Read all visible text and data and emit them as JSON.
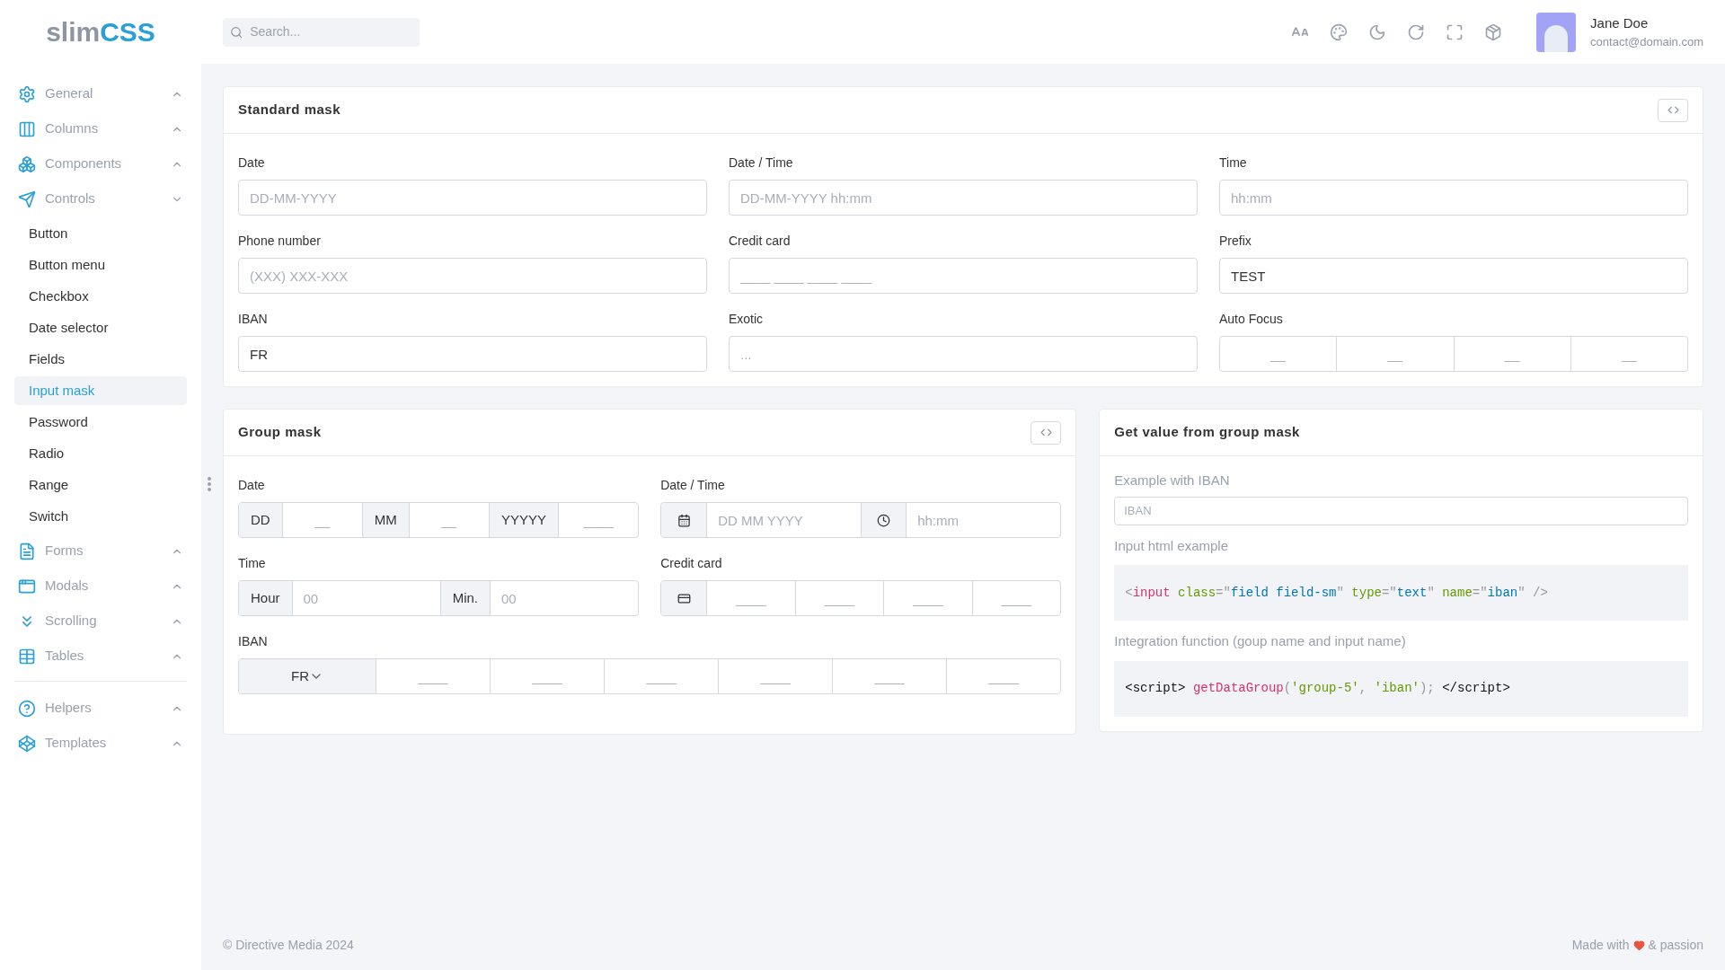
{
  "header": {
    "logo": [
      "slim",
      "CSS"
    ],
    "search": {
      "placeholder": "Search..."
    },
    "user": {
      "name": "Jane Doe",
      "email": "contact@domain.com"
    }
  },
  "sidebar": {
    "sections": [
      [
        {
          "label": "General",
          "expanded": false
        },
        {
          "label": "Columns",
          "expanded": false
        },
        {
          "label": "Components",
          "expanded": false
        },
        {
          "label": "Controls",
          "expanded": true,
          "children": [
            {
              "label": "Button",
              "selected": false
            },
            {
              "label": "Button menu",
              "selected": false
            },
            {
              "label": "Checkbox",
              "selected": false
            },
            {
              "label": "Date selector",
              "selected": false
            },
            {
              "label": "Fields",
              "selected": false
            },
            {
              "label": "Input mask",
              "selected": true
            },
            {
              "label": "Password",
              "selected": false
            },
            {
              "label": "Radio",
              "selected": false
            },
            {
              "label": "Range",
              "selected": false
            },
            {
              "label": "Switch",
              "selected": false
            }
          ]
        },
        {
          "label": "Forms",
          "expanded": false
        },
        {
          "label": "Modals",
          "expanded": false
        },
        {
          "label": "Scrolling",
          "expanded": false
        },
        {
          "label": "Tables",
          "expanded": false
        }
      ],
      [
        {
          "label": "Helpers",
          "expanded": false
        },
        {
          "label": "Templates",
          "expanded": false
        }
      ]
    ]
  },
  "standard_mask": {
    "title": "Standard mask",
    "fields": [
      {
        "label": "Date",
        "kind": "text",
        "placeholder": "DD-MM-YYYY"
      },
      {
        "label": "Date / Time",
        "kind": "text",
        "placeholder": "DD-MM-YYYY hh:mm"
      },
      {
        "label": "Time",
        "kind": "text",
        "placeholder": "hh:mm"
      },
      {
        "label": "Phone number",
        "kind": "text",
        "placeholder": "(XXX) XXX-XXX"
      },
      {
        "label": "Credit card",
        "kind": "text",
        "placeholder": "____ ____ ____ ____"
      },
      {
        "label": "Prefix",
        "kind": "text",
        "value": "TEST"
      },
      {
        "label": "IBAN",
        "kind": "text",
        "value": "FR"
      },
      {
        "label": "Exotic",
        "kind": "text",
        "placeholder": "..."
      },
      {
        "label": "Auto Focus",
        "kind": "segments",
        "segments": [
          {
            "placeholder": "__"
          },
          {
            "placeholder": "__"
          },
          {
            "placeholder": "__"
          },
          {
            "placeholder": "__"
          }
        ]
      }
    ]
  },
  "group_mask": {
    "title": "Group mask",
    "fields": [
      {
        "label": "Date",
        "parts": [
          {
            "kind": "addon",
            "text": "DD"
          },
          {
            "kind": "input",
            "placeholder": "__"
          },
          {
            "kind": "addon",
            "text": "MM"
          },
          {
            "kind": "input",
            "placeholder": "__"
          },
          {
            "kind": "addon",
            "text": "YYYYY"
          },
          {
            "kind": "input",
            "placeholder": "____"
          }
        ]
      },
      {
        "label": "Date / Time",
        "parts": [
          {
            "kind": "calendar"
          },
          {
            "kind": "text",
            "placeholder": "DD MM YYYY"
          },
          {
            "kind": "clock"
          },
          {
            "kind": "text",
            "placeholder": "hh:mm"
          }
        ]
      },
      {
        "label": "Time",
        "parts": [
          {
            "kind": "addon",
            "text": "Hour"
          },
          {
            "kind": "text",
            "placeholder": "00"
          },
          {
            "kind": "addon",
            "text": "Min."
          },
          {
            "kind": "text",
            "placeholder": "00"
          }
        ]
      },
      {
        "label": "Credit card",
        "parts": [
          {
            "kind": "card"
          },
          {
            "kind": "input",
            "placeholder": "____"
          },
          {
            "kind": "input",
            "placeholder": "____"
          },
          {
            "kind": "input",
            "placeholder": "____"
          },
          {
            "kind": "input",
            "placeholder": "____"
          }
        ]
      },
      {
        "label": "IBAN",
        "parts": [
          {
            "kind": "select",
            "value": "FR"
          },
          {
            "kind": "input",
            "placeholder": "____"
          },
          {
            "kind": "input",
            "placeholder": "____"
          },
          {
            "kind": "input",
            "placeholder": "____"
          },
          {
            "kind": "input",
            "placeholder": "____"
          },
          {
            "kind": "input",
            "placeholder": "____"
          },
          {
            "kind": "input",
            "placeholder": "____"
          }
        ]
      }
    ]
  },
  "get_value": {
    "title": "Get value from group mask",
    "blocks": [
      {
        "kind": "label",
        "text": "Example with IBAN"
      },
      {
        "kind": "input",
        "placeholder": "IBAN"
      },
      {
        "kind": "label",
        "text": "Input html example"
      },
      {
        "kind": "code",
        "tokens": [
          {
            "kind": "punct",
            "text": "<"
          },
          {
            "kind": "tag",
            "text": "input"
          },
          {
            "kind": "attr",
            "text": " class"
          },
          {
            "kind": "punct",
            "text": "=\""
          },
          {
            "kind": "value",
            "text": "field field-sm"
          },
          {
            "kind": "punct",
            "text": "\""
          },
          {
            "kind": "attr",
            "text": " type"
          },
          {
            "kind": "punct",
            "text": "=\""
          },
          {
            "kind": "value",
            "text": "text"
          },
          {
            "kind": "punct",
            "text": "\""
          },
          {
            "kind": "attr",
            "text": " name"
          },
          {
            "kind": "punct",
            "text": "=\""
          },
          {
            "kind": "value",
            "text": "iban"
          },
          {
            "kind": "punct",
            "text": "\" />"
          }
        ]
      },
      {
        "kind": "label",
        "text": "Integration function (goup name and input name)"
      },
      {
        "kind": "code",
        "tokens": [
          {
            "kind": "plain",
            "text": "<script> "
          },
          {
            "kind": "tag",
            "text": "getDataGroup"
          },
          {
            "kind": "punct",
            "text": "("
          },
          {
            "kind": "string",
            "text": "'group-5'"
          },
          {
            "kind": "punct",
            "text": ", "
          },
          {
            "kind": "string",
            "text": "'iban'"
          },
          {
            "kind": "punct",
            "text": "); "
          },
          {
            "kind": "plain",
            "text": "</script>"
          }
        ]
      }
    ]
  },
  "footer": {
    "copyright": "© Directive Media 2024",
    "made_with": "Made with",
    "passion": "& passion"
  }
}
